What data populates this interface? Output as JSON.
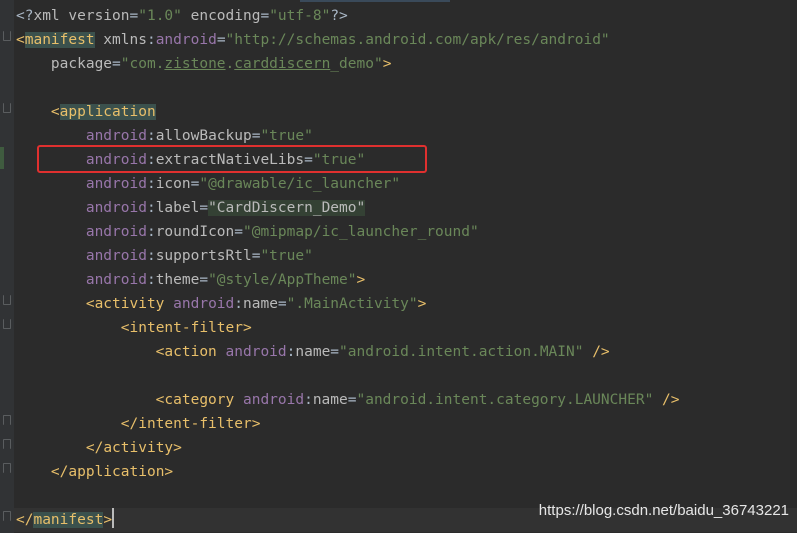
{
  "editor": {
    "lines": [
      {
        "id": "xml-decl",
        "parts": [
          {
            "t": "<?",
            "c": "punct"
          },
          {
            "t": "xml version",
            "c": "attr"
          },
          {
            "t": "=",
            "c": "punct"
          },
          {
            "t": "\"1.0\"",
            "c": "val"
          },
          {
            "t": " encoding",
            "c": "attr"
          },
          {
            "t": "=",
            "c": "punct"
          },
          {
            "t": "\"utf-8\"",
            "c": "val"
          },
          {
            "t": "?>",
            "c": "punct"
          }
        ]
      },
      {
        "id": "manifest-open",
        "parts": [
          {
            "t": "<",
            "c": "bracket"
          },
          {
            "t": "manifest",
            "c": "tag hl-tag"
          },
          {
            "t": " xmlns",
            "c": "attr"
          },
          {
            "t": ":",
            "c": "punct"
          },
          {
            "t": "android",
            "c": "ns"
          },
          {
            "t": "=",
            "c": "punct"
          },
          {
            "t": "\"http://schemas.android.com/apk/res/android\"",
            "c": "val"
          }
        ]
      },
      {
        "id": "package",
        "parts": [
          {
            "t": "    package",
            "c": "attr"
          },
          {
            "t": "=",
            "c": "punct"
          },
          {
            "t": "\"com.",
            "c": "val"
          },
          {
            "t": "zistone",
            "c": "val ul"
          },
          {
            "t": ".",
            "c": "val"
          },
          {
            "t": "carddiscern",
            "c": "val ul"
          },
          {
            "t": "_demo\"",
            "c": "val"
          },
          {
            "t": ">",
            "c": "bracket"
          }
        ]
      },
      {
        "id": "blank-1",
        "parts": []
      },
      {
        "id": "application-open",
        "parts": [
          {
            "t": "    <",
            "c": "bracket"
          },
          {
            "t": "application",
            "c": "tag hl-tag"
          }
        ]
      },
      {
        "id": "allow-backup",
        "parts": [
          {
            "t": "        android",
            "c": "ns"
          },
          {
            "t": ":",
            "c": "punct"
          },
          {
            "t": "allowBackup",
            "c": "attr"
          },
          {
            "t": "=",
            "c": "punct"
          },
          {
            "t": "\"true\"",
            "c": "val"
          }
        ]
      },
      {
        "id": "extract-native-libs",
        "parts": [
          {
            "t": "        android",
            "c": "ns"
          },
          {
            "t": ":",
            "c": "punct"
          },
          {
            "t": "extractNativeLibs",
            "c": "attr"
          },
          {
            "t": "=",
            "c": "punct"
          },
          {
            "t": "\"true\"",
            "c": "val"
          }
        ]
      },
      {
        "id": "icon",
        "parts": [
          {
            "t": "        android",
            "c": "ns"
          },
          {
            "t": ":",
            "c": "punct"
          },
          {
            "t": "icon",
            "c": "attr"
          },
          {
            "t": "=",
            "c": "punct"
          },
          {
            "t": "\"@drawable/ic_launcher\"",
            "c": "val"
          }
        ]
      },
      {
        "id": "label",
        "parts": [
          {
            "t": "        android",
            "c": "ns"
          },
          {
            "t": ":",
            "c": "punct"
          },
          {
            "t": "label",
            "c": "attr"
          },
          {
            "t": "=",
            "c": "punct"
          },
          {
            "t": "\"CardDiscern_Demo\"",
            "c": "attr hl-val"
          }
        ]
      },
      {
        "id": "round-icon",
        "parts": [
          {
            "t": "        android",
            "c": "ns"
          },
          {
            "t": ":",
            "c": "punct"
          },
          {
            "t": "roundIcon",
            "c": "attr"
          },
          {
            "t": "=",
            "c": "punct"
          },
          {
            "t": "\"@mipmap/ic_launcher_round\"",
            "c": "val"
          }
        ]
      },
      {
        "id": "supports-rtl",
        "parts": [
          {
            "t": "        android",
            "c": "ns"
          },
          {
            "t": ":",
            "c": "punct"
          },
          {
            "t": "supportsRtl",
            "c": "attr"
          },
          {
            "t": "=",
            "c": "punct"
          },
          {
            "t": "\"true\"",
            "c": "val"
          }
        ]
      },
      {
        "id": "theme",
        "parts": [
          {
            "t": "        android",
            "c": "ns"
          },
          {
            "t": ":",
            "c": "punct"
          },
          {
            "t": "theme",
            "c": "attr"
          },
          {
            "t": "=",
            "c": "punct"
          },
          {
            "t": "\"@style/AppTheme\"",
            "c": "val"
          },
          {
            "t": ">",
            "c": "bracket"
          }
        ]
      },
      {
        "id": "activity-open",
        "parts": [
          {
            "t": "        <",
            "c": "bracket"
          },
          {
            "t": "activity",
            "c": "tag"
          },
          {
            "t": " android",
            "c": "ns"
          },
          {
            "t": ":",
            "c": "punct"
          },
          {
            "t": "name",
            "c": "attr"
          },
          {
            "t": "=",
            "c": "punct"
          },
          {
            "t": "\".MainActivity\"",
            "c": "val"
          },
          {
            "t": ">",
            "c": "bracket"
          }
        ]
      },
      {
        "id": "intent-filter-open",
        "parts": [
          {
            "t": "            <",
            "c": "bracket"
          },
          {
            "t": "intent-filter",
            "c": "tag"
          },
          {
            "t": ">",
            "c": "bracket"
          }
        ]
      },
      {
        "id": "action",
        "parts": [
          {
            "t": "                <",
            "c": "bracket"
          },
          {
            "t": "action",
            "c": "tag"
          },
          {
            "t": " android",
            "c": "ns"
          },
          {
            "t": ":",
            "c": "punct"
          },
          {
            "t": "name",
            "c": "attr"
          },
          {
            "t": "=",
            "c": "punct"
          },
          {
            "t": "\"android.intent.action.MAIN\"",
            "c": "val"
          },
          {
            "t": " />",
            "c": "bracket"
          }
        ]
      },
      {
        "id": "blank-2",
        "parts": []
      },
      {
        "id": "category",
        "parts": [
          {
            "t": "                <",
            "c": "bracket"
          },
          {
            "t": "category",
            "c": "tag"
          },
          {
            "t": " android",
            "c": "ns"
          },
          {
            "t": ":",
            "c": "punct"
          },
          {
            "t": "name",
            "c": "attr"
          },
          {
            "t": "=",
            "c": "punct"
          },
          {
            "t": "\"android.intent.category.LAUNCHER\"",
            "c": "val"
          },
          {
            "t": " />",
            "c": "bracket"
          }
        ]
      },
      {
        "id": "intent-filter-close",
        "parts": [
          {
            "t": "            </",
            "c": "bracket"
          },
          {
            "t": "intent-filter",
            "c": "tag"
          },
          {
            "t": ">",
            "c": "bracket"
          }
        ]
      },
      {
        "id": "activity-close",
        "parts": [
          {
            "t": "        </",
            "c": "bracket"
          },
          {
            "t": "activity",
            "c": "tag"
          },
          {
            "t": ">",
            "c": "bracket"
          }
        ]
      },
      {
        "id": "application-close",
        "parts": [
          {
            "t": "    </",
            "c": "bracket"
          },
          {
            "t": "application",
            "c": "tag"
          },
          {
            "t": ">",
            "c": "bracket"
          }
        ]
      },
      {
        "id": "blank-3",
        "parts": []
      },
      {
        "id": "manifest-close",
        "parts": [
          {
            "t": "</",
            "c": "bracket"
          },
          {
            "t": "manifest",
            "c": "tag hl-tag"
          },
          {
            "t": ">",
            "c": "bracket"
          }
        ]
      }
    ]
  },
  "watermark": "https://blog.csdn.net/baidu_36743221",
  "colors": {
    "background": "#2b2b2b",
    "tag": "#e8bf6a",
    "namespace": "#9876aa",
    "attribute": "#bababa",
    "value": "#6a8759",
    "highlight_box": "#e0302f"
  }
}
